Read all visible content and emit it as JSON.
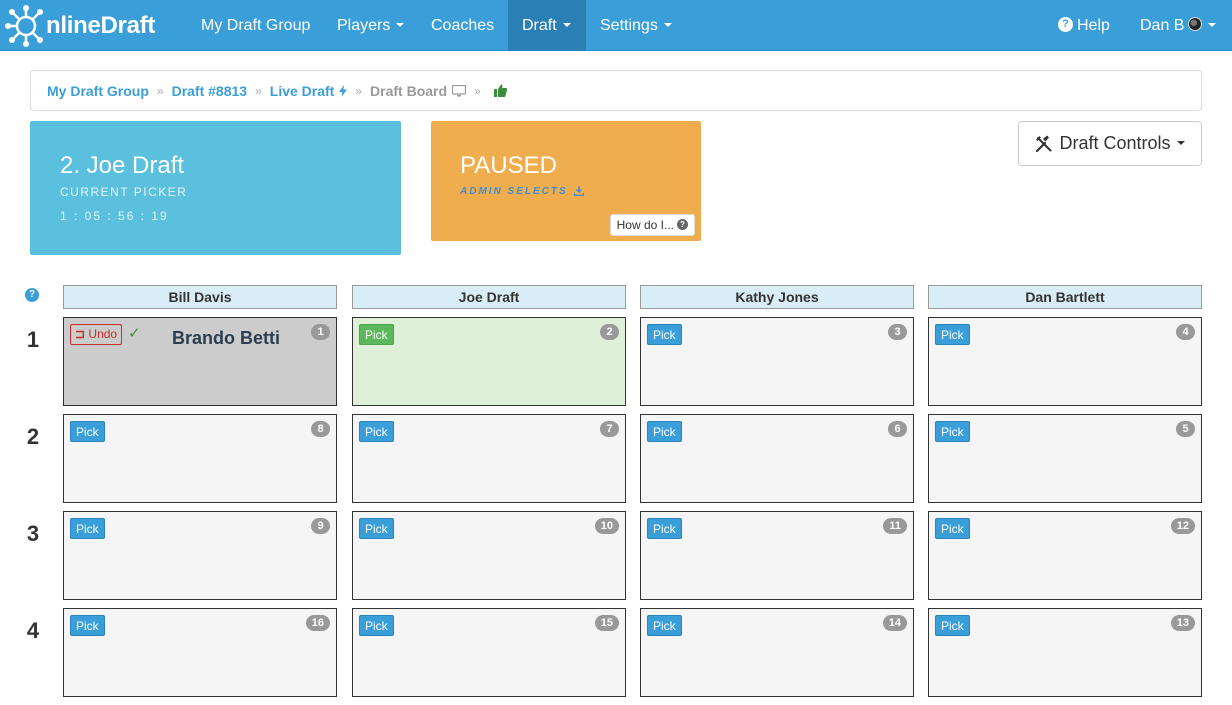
{
  "nav": {
    "brand": "nlineDraft",
    "items": [
      {
        "label": "My Draft Group"
      },
      {
        "label": "Players"
      },
      {
        "label": "Coaches"
      },
      {
        "label": "Draft"
      },
      {
        "label": "Settings"
      }
    ],
    "help": "Help",
    "user": "Dan B",
    "colors": {
      "bar": "#3a9fd9",
      "active": "#2a7fb5"
    }
  },
  "breadcrumb": {
    "items": [
      "My Draft Group",
      "Draft #8813",
      "Live Draft",
      "Draft Board"
    ]
  },
  "picker": {
    "name": "2. Joe Draft",
    "label": "CURRENT PICKER",
    "timer": "1 : 05 : 56 : 19",
    "color": "#5bc0de"
  },
  "status": {
    "title": "PAUSED",
    "subtitle": "ADMIN SELECTS",
    "help_button": "How do I...",
    "color": "#f0ad4e"
  },
  "controls": {
    "label": "Draft Controls"
  },
  "board": {
    "teams": [
      "Bill Davis",
      "Joe Draft",
      "Kathy Jones",
      "Dan Bartlett"
    ],
    "rounds": [
      {
        "round": "1",
        "cells": [
          {
            "pick": "1",
            "state": "made",
            "player": "Brando Betti",
            "undo": "Undo"
          },
          {
            "pick": "2",
            "state": "current",
            "button": "Pick"
          },
          {
            "pick": "3",
            "state": "open",
            "button": "Pick"
          },
          {
            "pick": "4",
            "state": "open",
            "button": "Pick"
          }
        ]
      },
      {
        "round": "2",
        "cells": [
          {
            "pick": "8",
            "state": "open",
            "button": "Pick"
          },
          {
            "pick": "7",
            "state": "open",
            "button": "Pick"
          },
          {
            "pick": "6",
            "state": "open",
            "button": "Pick"
          },
          {
            "pick": "5",
            "state": "open",
            "button": "Pick"
          }
        ]
      },
      {
        "round": "3",
        "cells": [
          {
            "pick": "9",
            "state": "open",
            "button": "Pick"
          },
          {
            "pick": "10",
            "state": "open",
            "button": "Pick"
          },
          {
            "pick": "11",
            "state": "open",
            "button": "Pick"
          },
          {
            "pick": "12",
            "state": "open",
            "button": "Pick"
          }
        ]
      },
      {
        "round": "4",
        "cells": [
          {
            "pick": "16",
            "state": "open",
            "button": "Pick"
          },
          {
            "pick": "15",
            "state": "open",
            "button": "Pick"
          },
          {
            "pick": "14",
            "state": "open",
            "button": "Pick"
          },
          {
            "pick": "13",
            "state": "open",
            "button": "Pick"
          }
        ]
      }
    ]
  }
}
